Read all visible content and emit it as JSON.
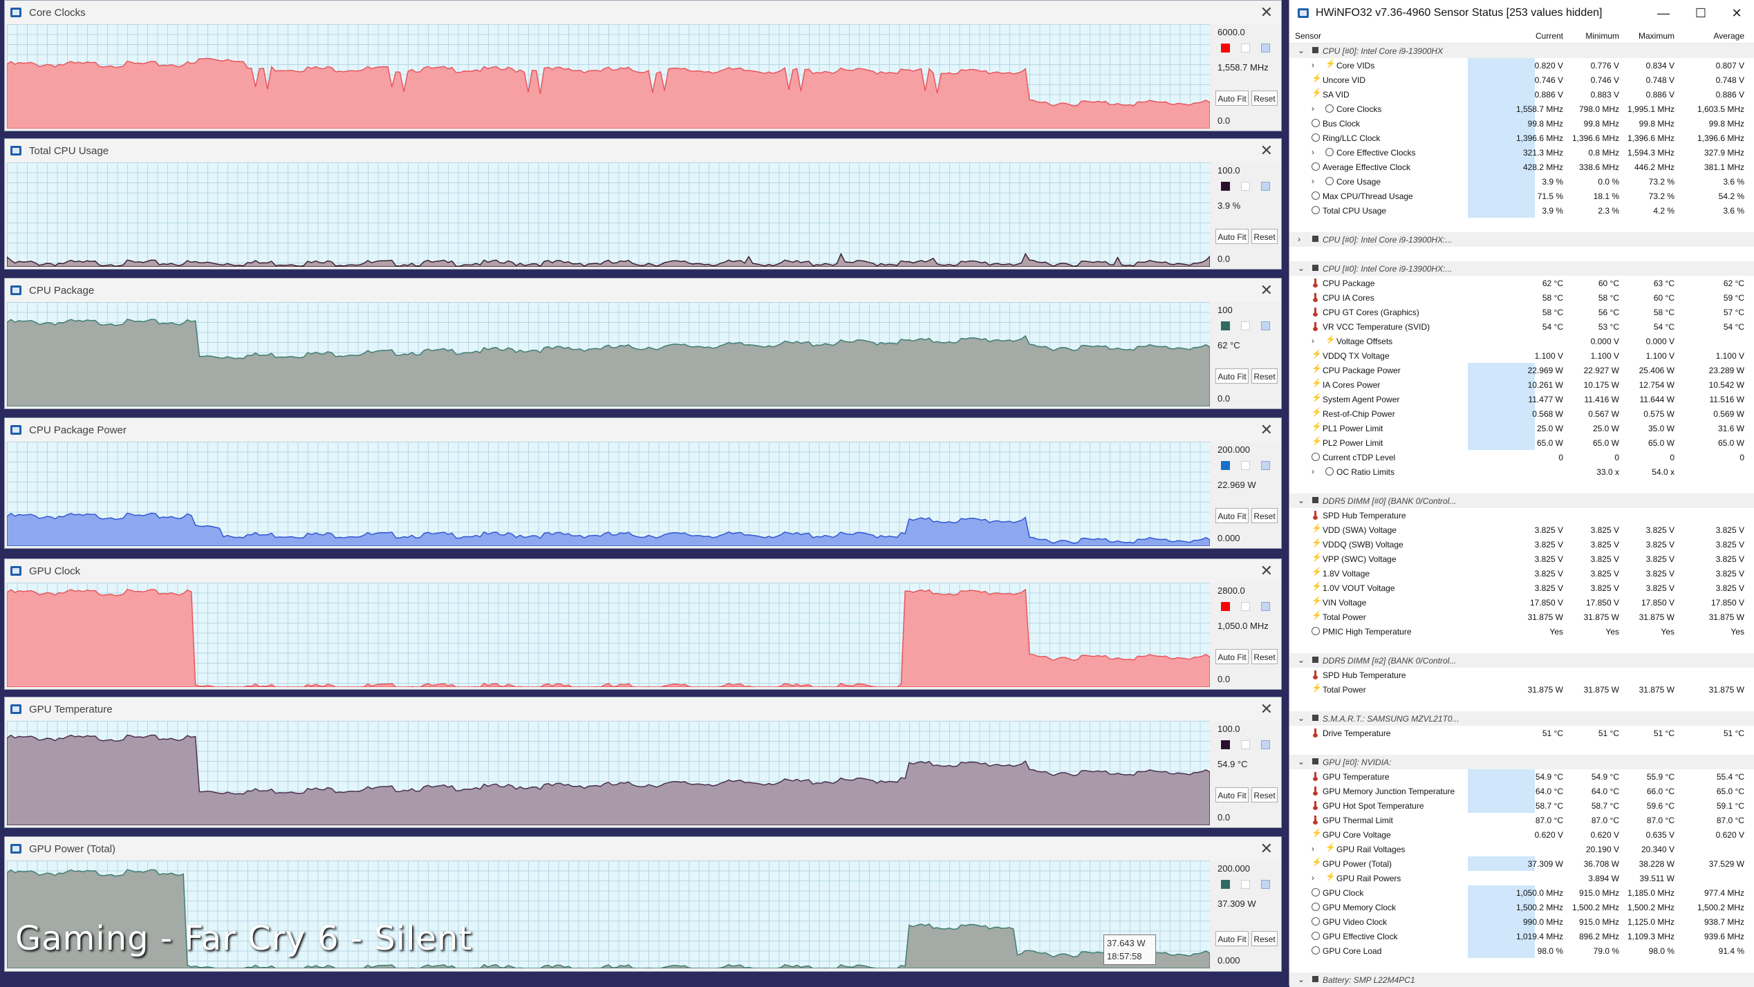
{
  "graph_windows": [
    {
      "id": "core-clocks",
      "title": "Core Clocks",
      "max": "6000.0",
      "current": "1,558.7 MHz",
      "min": "0.0",
      "autofit": "Auto Fit",
      "reset": "Reset",
      "line_color": "#ff0000",
      "fill_color": "#f7a0a3",
      "stroke_color": "#e8555c",
      "swatch_color": "#ff0000"
    },
    {
      "id": "total-cpu-usage",
      "title": "Total CPU Usage",
      "max": "100.0",
      "current": "3.9 %",
      "min": "0.0",
      "autofit": "Auto Fit",
      "reset": "Reset",
      "line_color": "#2b0f2e",
      "fill_color": "#b3a1a8",
      "stroke_color": "#3c2136",
      "swatch_color": "#2b0f2e"
    },
    {
      "id": "cpu-package",
      "title": "CPU Package",
      "max": "100",
      "current": "62 °C",
      "min": "0.0",
      "autofit": "Auto Fit",
      "reset": "Reset",
      "line_color": "#2e6b62",
      "fill_color": "#a4aaa5",
      "stroke_color": "#3f7e72",
      "swatch_color": "#2e6b62"
    },
    {
      "id": "cpu-package-power",
      "title": "CPU Package Power",
      "max": "200.000",
      "current": "22.969 W",
      "min": "0.000",
      "autofit": "Auto Fit",
      "reset": "Reset",
      "line_color": "#1670c9",
      "fill_color": "#8ea8ef",
      "stroke_color": "#3157d6",
      "swatch_color": "#1670c9"
    },
    {
      "id": "gpu-clock",
      "title": "GPU Clock",
      "max": "2800.0",
      "current": "1,050.0 MHz",
      "min": "0.0",
      "autofit": "Auto Fit",
      "reset": "Reset",
      "line_color": "#ff0000",
      "fill_color": "#f7a0a3",
      "stroke_color": "#e8555c",
      "swatch_color": "#ff0000"
    },
    {
      "id": "gpu-temperature",
      "title": "GPU Temperature",
      "max": "100.0",
      "current": "54.9 °C",
      "min": "0.0",
      "autofit": "Auto Fit",
      "reset": "Reset",
      "line_color": "#2b0f2e",
      "fill_color": "#a99aa9",
      "stroke_color": "#4a3050",
      "swatch_color": "#2b0f2e"
    },
    {
      "id": "gpu-power-total",
      "title": "GPU Power (Total)",
      "max": "200.000",
      "current": "37.309 W",
      "min": "0.000",
      "autofit": "Auto Fit",
      "reset": "Reset",
      "line_color": "#2e6b62",
      "fill_color": "#a4aaa5",
      "stroke_color": "#3f7e72",
      "swatch_color": "#2e6b62"
    }
  ],
  "overlay_title": "Gaming - Far Cry 6 - Silent",
  "tooltip": {
    "value": "37.643 W",
    "time": "18:57:58"
  },
  "sensor_window": {
    "title": "HWiNFO32 v7.36-4960 Sensor Status [253 values hidden]",
    "columns": {
      "sensor": "Sensor",
      "current": "Current",
      "minimum": "Minimum",
      "maximum": "Maximum",
      "average": "Average"
    }
  },
  "sensor_rows": [
    {
      "type": "group",
      "label": "CPU [#0]: Intel Core i9-13900HX",
      "expanded": true
    },
    {
      "type": "row",
      "icon": "bolt",
      "sub": true,
      "expander": true,
      "label": "Core VIDs",
      "cur": "0.820 V",
      "min": "0.776 V",
      "max": "0.834 V",
      "avg": "0.807 V",
      "hl": true
    },
    {
      "type": "row",
      "icon": "bolt",
      "label": "Uncore VID",
      "cur": "0.746 V",
      "min": "0.746 V",
      "max": "0.748 V",
      "avg": "0.748 V",
      "hl": true
    },
    {
      "type": "row",
      "icon": "bolt",
      "label": "SA VID",
      "cur": "0.886 V",
      "min": "0.883 V",
      "max": "0.886 V",
      "avg": "0.886 V",
      "hl": true
    },
    {
      "type": "row",
      "icon": "clock",
      "sub": true,
      "expander": true,
      "label": "Core Clocks",
      "cur": "1,558.7 MHz",
      "min": "798.0 MHz",
      "max": "1,995.1 MHz",
      "avg": "1,603.5 MHz",
      "hl": true
    },
    {
      "type": "row",
      "icon": "clock",
      "label": "Bus Clock",
      "cur": "99.8 MHz",
      "min": "99.8 MHz",
      "max": "99.8 MHz",
      "avg": "99.8 MHz",
      "hl": true
    },
    {
      "type": "row",
      "icon": "clock",
      "label": "Ring/LLC Clock",
      "cur": "1,396.6 MHz",
      "min": "1,396.6 MHz",
      "max": "1,396.6 MHz",
      "avg": "1,396.6 MHz",
      "hl": true
    },
    {
      "type": "row",
      "icon": "clock",
      "sub": true,
      "expander": true,
      "label": "Core Effective Clocks",
      "cur": "321.3 MHz",
      "min": "0.8 MHz",
      "max": "1,594.3 MHz",
      "avg": "327.9 MHz",
      "hl": true
    },
    {
      "type": "row",
      "icon": "clock",
      "label": "Average Effective Clock",
      "cur": "428.2 MHz",
      "min": "338.6 MHz",
      "max": "446.2 MHz",
      "avg": "381.1 MHz",
      "hl": true
    },
    {
      "type": "row",
      "icon": "clock",
      "sub": true,
      "expander": true,
      "label": "Core Usage",
      "cur": "3.9 %",
      "min": "0.0 %",
      "max": "73.2 %",
      "avg": "3.6 %",
      "hl": true
    },
    {
      "type": "row",
      "icon": "clock",
      "label": "Max CPU/Thread Usage",
      "cur": "71.5 %",
      "min": "18.1 %",
      "max": "73.2 %",
      "avg": "54.2 %",
      "hl": true
    },
    {
      "type": "row",
      "icon": "clock",
      "label": "Total CPU Usage",
      "cur": "3.9 %",
      "min": "2.3 %",
      "max": "4.2 %",
      "avg": "3.6 %",
      "hl": true
    },
    {
      "type": "blank"
    },
    {
      "type": "group",
      "label": "CPU [#0]: Intel Core i9-13900HX:...",
      "expanded": false
    },
    {
      "type": "blank"
    },
    {
      "type": "group",
      "label": "CPU [#0]: Intel Core i9-13900HX:...",
      "expanded": true
    },
    {
      "type": "row",
      "icon": "thermo",
      "label": "CPU Package",
      "cur": "62 °C",
      "min": "60 °C",
      "max": "63 °C",
      "avg": "62 °C"
    },
    {
      "type": "row",
      "icon": "thermo",
      "label": "CPU IA Cores",
      "cur": "58 °C",
      "min": "58 °C",
      "max": "60 °C",
      "avg": "59 °C"
    },
    {
      "type": "row",
      "icon": "thermo",
      "label": "CPU GT Cores (Graphics)",
      "cur": "58 °C",
      "min": "56 °C",
      "max": "58 °C",
      "avg": "57 °C"
    },
    {
      "type": "row",
      "icon": "thermo",
      "label": "VR VCC Temperature (SVID)",
      "cur": "54 °C",
      "min": "53 °C",
      "max": "54 °C",
      "avg": "54 °C"
    },
    {
      "type": "row",
      "icon": "bolt",
      "sub": true,
      "expander": true,
      "label": "Voltage Offsets",
      "cur": "",
      "min": "0.000 V",
      "max": "0.000 V",
      "avg": ""
    },
    {
      "type": "row",
      "icon": "bolt",
      "label": "VDDQ TX Voltage",
      "cur": "1.100 V",
      "min": "1.100 V",
      "max": "1.100 V",
      "avg": "1.100 V"
    },
    {
      "type": "row",
      "icon": "bolt",
      "label": "CPU Package Power",
      "cur": "22.969 W",
      "min": "22.927 W",
      "max": "25.406 W",
      "avg": "23.289 W",
      "hl": true
    },
    {
      "type": "row",
      "icon": "bolt",
      "label": "IA Cores Power",
      "cur": "10.261 W",
      "min": "10.175 W",
      "max": "12.754 W",
      "avg": "10.542 W",
      "hl": true
    },
    {
      "type": "row",
      "icon": "bolt",
      "label": "System Agent Power",
      "cur": "11.477 W",
      "min": "11.416 W",
      "max": "11.644 W",
      "avg": "11.516 W",
      "hl": true
    },
    {
      "type": "row",
      "icon": "bolt",
      "label": "Rest-of-Chip Power",
      "cur": "0.568 W",
      "min": "0.567 W",
      "max": "0.575 W",
      "avg": "0.569 W",
      "hl": true
    },
    {
      "type": "row",
      "icon": "bolt",
      "label": "PL1 Power Limit",
      "cur": "25.0 W",
      "min": "25.0 W",
      "max": "35.0 W",
      "avg": "31.6 W",
      "hl": true
    },
    {
      "type": "row",
      "icon": "bolt",
      "label": "PL2 Power Limit",
      "cur": "65.0 W",
      "min": "65.0 W",
      "max": "65.0 W",
      "avg": "65.0 W",
      "hl": true
    },
    {
      "type": "row",
      "icon": "clock",
      "label": "Current cTDP Level",
      "cur": "0",
      "min": "0",
      "max": "0",
      "avg": "0"
    },
    {
      "type": "row",
      "icon": "clock",
      "sub": true,
      "expander": true,
      "label": "OC Ratio Limits",
      "cur": "",
      "min": "33.0 x",
      "max": "54.0 x",
      "avg": ""
    },
    {
      "type": "blank"
    },
    {
      "type": "group",
      "label": "DDR5 DIMM [#0] (BANK 0/Control...",
      "expanded": true
    },
    {
      "type": "row",
      "icon": "thermo",
      "label": "SPD Hub Temperature",
      "cur": "",
      "min": "",
      "max": "",
      "avg": ""
    },
    {
      "type": "row",
      "icon": "bolt",
      "label": "VDD (SWA) Voltage",
      "cur": "3.825 V",
      "min": "3.825 V",
      "max": "3.825 V",
      "avg": "3.825 V"
    },
    {
      "type": "row",
      "icon": "bolt",
      "label": "VDDQ (SWB) Voltage",
      "cur": "3.825 V",
      "min": "3.825 V",
      "max": "3.825 V",
      "avg": "3.825 V"
    },
    {
      "type": "row",
      "icon": "bolt",
      "label": "VPP (SWC) Voltage",
      "cur": "3.825 V",
      "min": "3.825 V",
      "max": "3.825 V",
      "avg": "3.825 V"
    },
    {
      "type": "row",
      "icon": "bolt",
      "label": "1.8V Voltage",
      "cur": "3.825 V",
      "min": "3.825 V",
      "max": "3.825 V",
      "avg": "3.825 V"
    },
    {
      "type": "row",
      "icon": "bolt",
      "label": "1.0V VOUT Voltage",
      "cur": "3.825 V",
      "min": "3.825 V",
      "max": "3.825 V",
      "avg": "3.825 V"
    },
    {
      "type": "row",
      "icon": "bolt",
      "label": "VIN Voltage",
      "cur": "17.850 V",
      "min": "17.850 V",
      "max": "17.850 V",
      "avg": "17.850 V"
    },
    {
      "type": "row",
      "icon": "bolt",
      "label": "Total Power",
      "cur": "31.875 W",
      "min": "31.875 W",
      "max": "31.875 W",
      "avg": "31.875 W"
    },
    {
      "type": "row",
      "icon": "clock",
      "label": "PMIC High Temperature",
      "cur": "Yes",
      "min": "Yes",
      "max": "Yes",
      "avg": "Yes"
    },
    {
      "type": "blank"
    },
    {
      "type": "group",
      "label": "DDR5 DIMM [#2] (BANK 0/Control...",
      "expanded": true
    },
    {
      "type": "row",
      "icon": "thermo",
      "label": "SPD Hub Temperature",
      "cur": "",
      "min": "",
      "max": "",
      "avg": ""
    },
    {
      "type": "row",
      "icon": "bolt",
      "label": "Total Power",
      "cur": "31.875 W",
      "min": "31.875 W",
      "max": "31.875 W",
      "avg": "31.875 W"
    },
    {
      "type": "blank"
    },
    {
      "type": "group",
      "label": "S.M.A.R.T.: SAMSUNG MZVL21T0...",
      "expanded": true
    },
    {
      "type": "row",
      "icon": "thermo",
      "label": "Drive Temperature",
      "cur": "51 °C",
      "min": "51 °C",
      "max": "51 °C",
      "avg": "51 °C"
    },
    {
      "type": "blank"
    },
    {
      "type": "group",
      "label": "GPU [#0]: NVIDIA:",
      "expanded": true
    },
    {
      "type": "row",
      "icon": "thermo",
      "label": "GPU Temperature",
      "cur": "54.9 °C",
      "min": "54.9 °C",
      "max": "55.9 °C",
      "avg": "55.4 °C",
      "hl": true
    },
    {
      "type": "row",
      "icon": "thermo",
      "label": "GPU Memory Junction Temperature",
      "cur": "64.0 °C",
      "min": "64.0 °C",
      "max": "66.0 °C",
      "avg": "65.0 °C",
      "hl": true
    },
    {
      "type": "row",
      "icon": "thermo",
      "label": "GPU Hot Spot Temperature",
      "cur": "58.7 °C",
      "min": "58.7 °C",
      "max": "59.6 °C",
      "avg": "59.1 °C",
      "hl": true
    },
    {
      "type": "row",
      "icon": "thermo",
      "label": "GPU Thermal Limit",
      "cur": "87.0 °C",
      "min": "87.0 °C",
      "max": "87.0 °C",
      "avg": "87.0 °C"
    },
    {
      "type": "row",
      "icon": "bolt",
      "label": "GPU Core Voltage",
      "cur": "0.620 V",
      "min": "0.620 V",
      "max": "0.635 V",
      "avg": "0.620 V"
    },
    {
      "type": "row",
      "icon": "bolt",
      "sub": true,
      "expander": true,
      "label": "GPU Rail Voltages",
      "cur": "",
      "min": "20.190 V",
      "max": "20.340 V",
      "avg": ""
    },
    {
      "type": "row",
      "icon": "bolt",
      "label": "GPU Power (Total)",
      "cur": "37.309 W",
      "min": "36.708 W",
      "max": "38.228 W",
      "avg": "37.529 W",
      "hl": true
    },
    {
      "type": "row",
      "icon": "bolt",
      "sub": true,
      "expander": true,
      "label": "GPU Rail Powers",
      "cur": "",
      "min": "3.894 W",
      "max": "39.511 W",
      "avg": ""
    },
    {
      "type": "row",
      "icon": "clock",
      "label": "GPU Clock",
      "cur": "1,050.0 MHz",
      "min": "915.0 MHz",
      "max": "1,185.0 MHz",
      "avg": "977.4 MHz",
      "hl": true
    },
    {
      "type": "row",
      "icon": "clock",
      "label": "GPU Memory Clock",
      "cur": "1,500.2 MHz",
      "min": "1,500.2 MHz",
      "max": "1,500.2 MHz",
      "avg": "1,500.2 MHz",
      "hl": true
    },
    {
      "type": "row",
      "icon": "clock",
      "label": "GPU Video Clock",
      "cur": "990.0 MHz",
      "min": "915.0 MHz",
      "max": "1,125.0 MHz",
      "avg": "938.7 MHz",
      "hl": true
    },
    {
      "type": "row",
      "icon": "clock",
      "label": "GPU Effective Clock",
      "cur": "1,019.4 MHz",
      "min": "896.2 MHz",
      "max": "1,109.3 MHz",
      "avg": "939.6 MHz",
      "hl": true
    },
    {
      "type": "row",
      "icon": "clock",
      "label": "GPU Core Load",
      "cur": "98.0 %",
      "min": "79.0 %",
      "max": "98.0 %",
      "avg": "91.4 %",
      "hl": true
    },
    {
      "type": "blank"
    },
    {
      "type": "group",
      "label": "Battery: SMP L22M4PC1",
      "expanded": true
    }
  ]
}
